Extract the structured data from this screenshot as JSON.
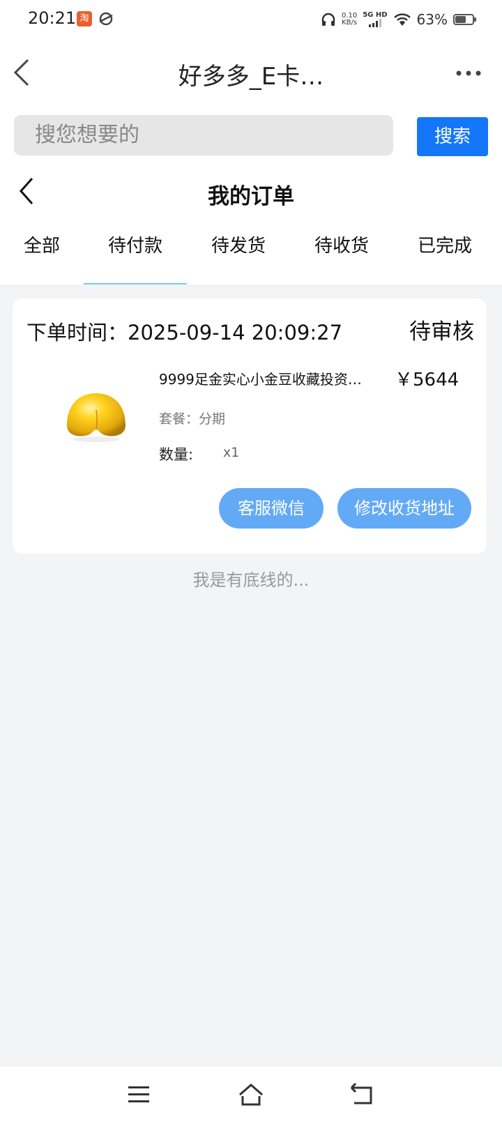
{
  "status_bar": {
    "time": "20:21",
    "app_icon_text": "淘",
    "speed_value": "0.10",
    "speed_unit": "KB/s",
    "network": "5G HD",
    "battery_text": "63%",
    "battery_level": 0.63
  },
  "title_bar": {
    "title": "好多多_E卡…"
  },
  "search": {
    "placeholder": "搜您想要的",
    "button_label": "搜索",
    "accent_color": "#1477f8"
  },
  "page": {
    "title": "我的订单"
  },
  "tabs": [
    {
      "label": "全部",
      "active": false
    },
    {
      "label": "待付款",
      "active": true
    },
    {
      "label": "待发货",
      "active": false
    },
    {
      "label": "待收货",
      "active": false
    },
    {
      "label": "已完成",
      "active": false
    }
  ],
  "order": {
    "time_label": "下单时间：",
    "time_value": "2025-09-14 20:09:27",
    "status": "待审核",
    "product_name": "9999足金实心小金豆收藏投资…",
    "price": "￥5644",
    "package_label": "套餐：",
    "package_value": "分期",
    "quantity_label": "数量:",
    "quantity_value": "x1",
    "buttons": {
      "wechat": "客服微信",
      "change_address": "修改收货地址"
    },
    "button_color": "#62aaf5"
  },
  "footer_text": "我是有底线的..."
}
